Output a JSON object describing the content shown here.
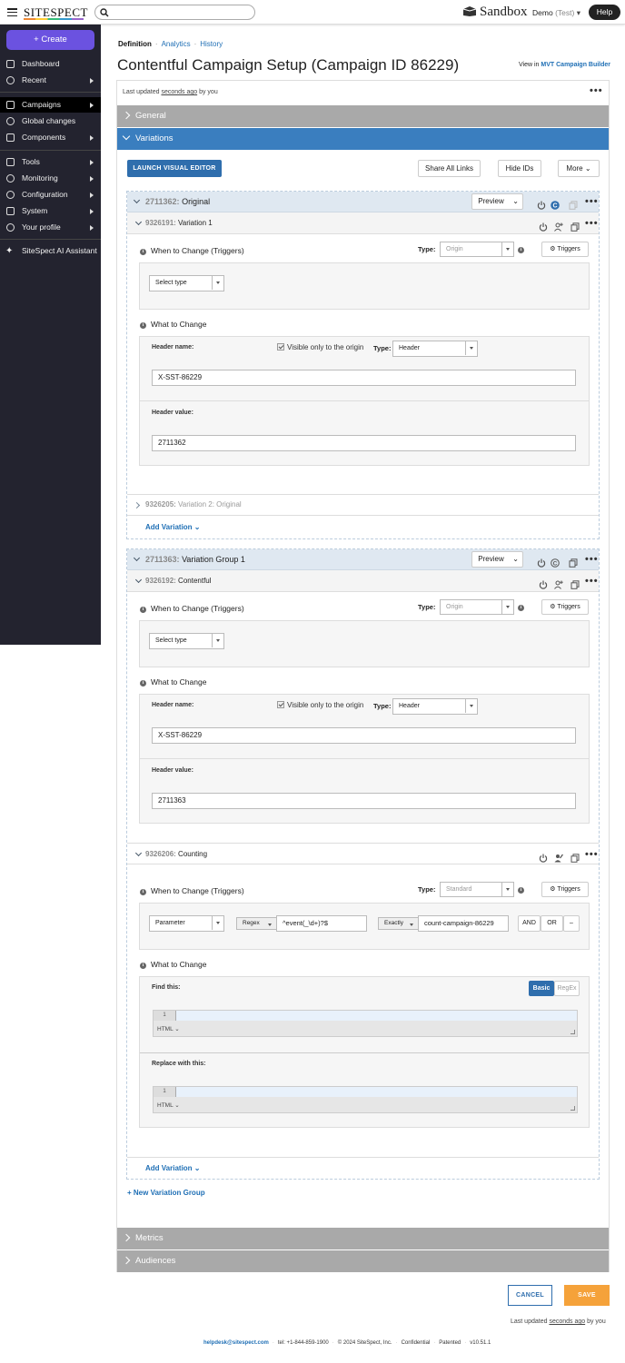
{
  "topbar": {
    "brand": "SITESPECT",
    "search_placeholder": "",
    "env_label": "Sandbox",
    "account": "Demo",
    "account_tag": "(Test)",
    "help": "Help"
  },
  "sidebar": {
    "create": "Create",
    "items": [
      {
        "label": "Dashboard",
        "icon": "dashboard-icon",
        "arrow": false
      },
      {
        "label": "Recent",
        "icon": "clock-icon",
        "arrow": true
      },
      {
        "label": "Campaigns",
        "icon": "rocket-icon",
        "arrow": true,
        "active": true
      },
      {
        "label": "Global changes",
        "icon": "globe-icon",
        "arrow": false
      },
      {
        "label": "Components",
        "icon": "folder-icon",
        "arrow": true
      },
      {
        "label": "Tools",
        "icon": "wrench-icon",
        "arrow": true
      },
      {
        "label": "Monitoring",
        "icon": "eye-icon",
        "arrow": true
      },
      {
        "label": "Configuration",
        "icon": "gear-icon",
        "arrow": true
      },
      {
        "label": "System",
        "icon": "monitor-icon",
        "arrow": true
      },
      {
        "label": "Your profile",
        "icon": "user-icon",
        "arrow": true
      },
      {
        "label": "SiteSpect AI Assistant",
        "icon": "sparkle-icon",
        "arrow": false
      }
    ]
  },
  "breadcrumb": {
    "current": "Definition",
    "links": [
      "Analytics",
      "History"
    ]
  },
  "page": {
    "title": "Contentful Campaign Setup (Campaign ID 86229)",
    "view_in": "View in",
    "view_link": "MVT Campaign Builder"
  },
  "updated": {
    "prefix": "Last updated",
    "when": "seconds ago",
    "suffix": "by you"
  },
  "sections": {
    "general": "General",
    "variations": "Variations",
    "metrics": "Metrics",
    "audiences": "Audiences"
  },
  "toolbar": {
    "launch": "LAUNCH VISUAL EDITOR",
    "share": "Share All Links",
    "hide_ids": "Hide IDs",
    "more": "More"
  },
  "labels": {
    "preview": "Preview",
    "when": "When to Change (Triggers)",
    "what": "What to Change",
    "type": "Type:",
    "triggers": "Triggers",
    "header_name": "Header name:",
    "header_value": "Header value:",
    "visible_origin": "Visible only to the origin",
    "add_variation": "Add Variation",
    "new_group": "New Variation Group",
    "find": "Find this:",
    "replace": "Replace with this:",
    "basic": "Basic",
    "regex_tab": "RegEx",
    "html": "HTML",
    "line1": "1"
  },
  "groups": [
    {
      "id": "2711362:",
      "name": "Original",
      "v1": {
        "id": "9326191:",
        "name": "Variation 1",
        "trigger_type": "Origin",
        "select": "Select type",
        "header_type": "Header",
        "header_name": "X-SST-86229",
        "header_value": "2711362"
      },
      "v2": {
        "id": "9326205:",
        "name": "Variation 2: Original"
      }
    },
    {
      "id": "2711363:",
      "name": "Variation Group 1",
      "v1": {
        "id": "9326192:",
        "name": "Contentful",
        "trigger_type": "Origin",
        "select": "Select type",
        "header_type": "Header",
        "header_name": "X-SST-86229",
        "header_value": "2711363"
      },
      "v2": {
        "id": "9326206:",
        "name": "Counting",
        "trigger_type": "Standard",
        "param": "Parameter",
        "match": "Regex",
        "pattern": "^event(_\\d+)?$",
        "exact": "Exactly",
        "value": "count-campaign-86229",
        "and": "AND",
        "or": "OR",
        "minus": "–"
      }
    }
  ],
  "footer": {
    "cancel": "CANCEL",
    "save": "SAVE",
    "email": "helpdesk@sitespect.com",
    "tel": "tel: +1-844-859-1900",
    "copy": "© 2024 SiteSpect, Inc.",
    "conf": "Confidential",
    "pat": "Patented",
    "ver": "v10.51.1"
  },
  "colors": {
    "accent": "#6b52e0",
    "link": "#1f6fb5",
    "section_blue": "#3a7ebf",
    "save": "#f5a23a"
  }
}
